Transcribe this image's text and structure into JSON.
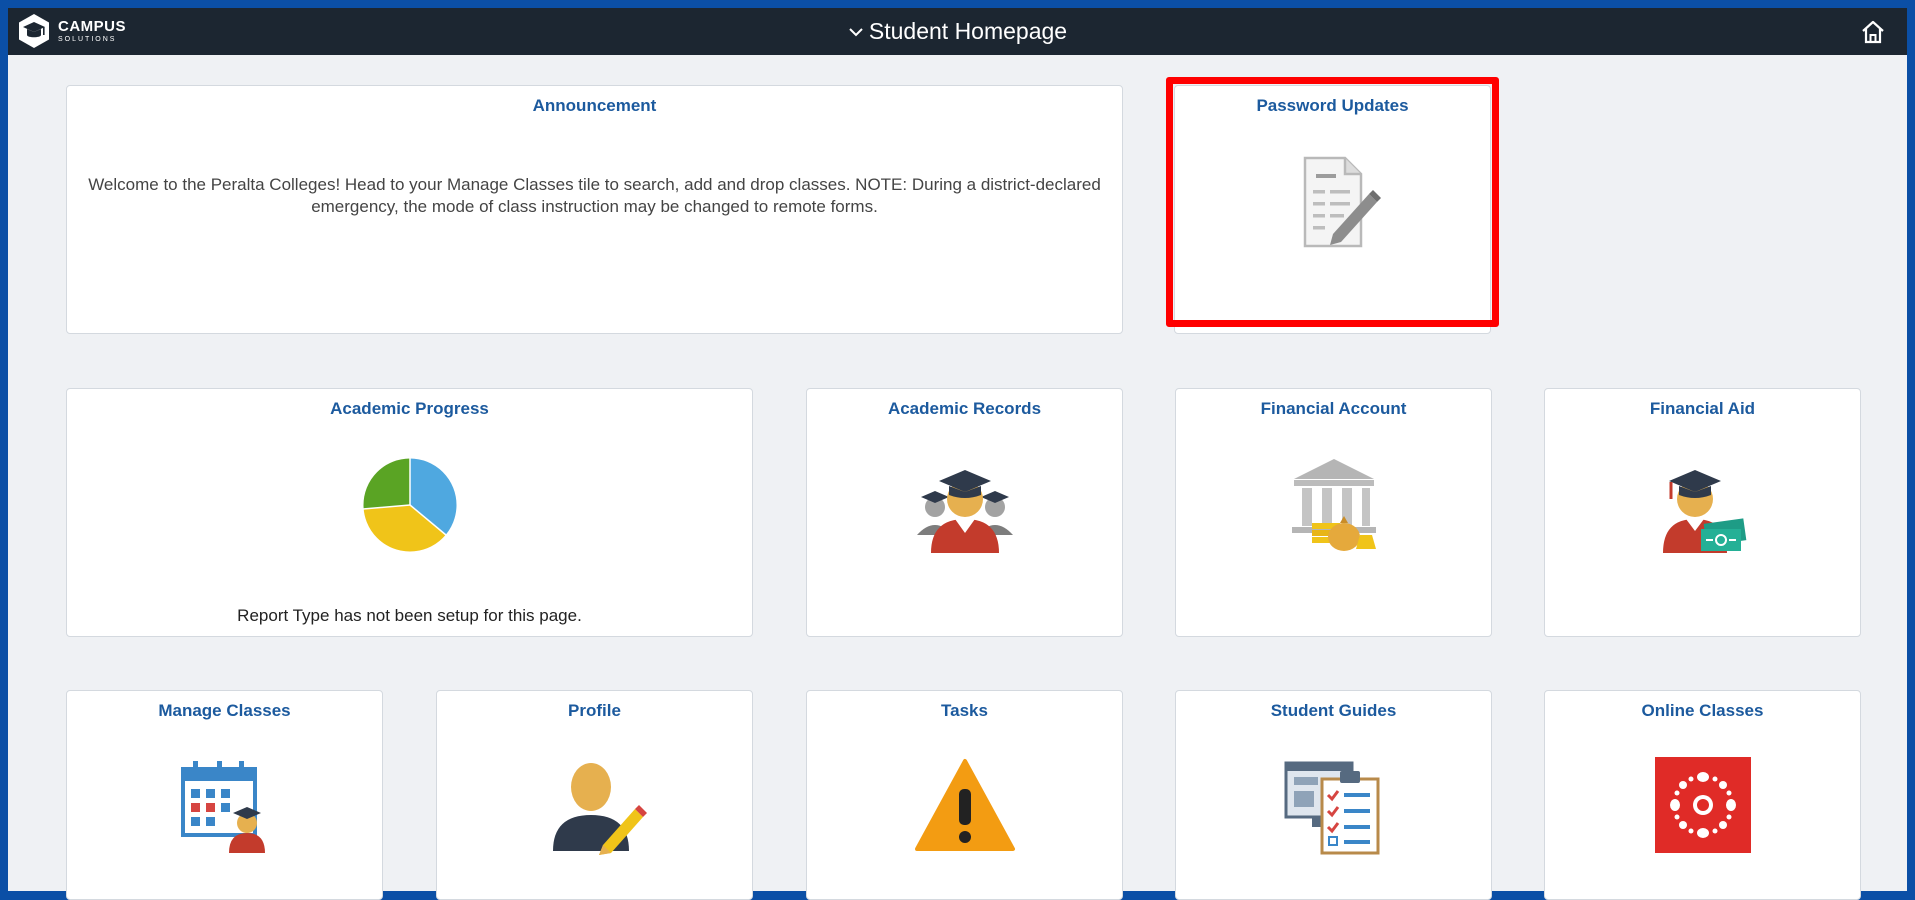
{
  "header": {
    "logo_big": "CAMPUS",
    "logo_small": "SOLUTIONS",
    "title": "Student Homepage",
    "title_icon": "chevron-down-icon",
    "home_icon": "home-icon"
  },
  "tiles": {
    "announcement": {
      "title": "Announcement",
      "text": "Welcome to the Peralta Colleges! Head to your Manage Classes tile to search, add and drop classes. NOTE: During a district-declared emergency, the mode of class instruction may be changed to remote forms."
    },
    "password_updates": {
      "title": "Password Updates",
      "icon": "document-edit-icon"
    },
    "academic_progress": {
      "title": "Academic Progress",
      "icon": "pie-chart-icon",
      "note": "Report Type has not been setup for this page."
    },
    "academic_records": {
      "title": "Academic Records",
      "icon": "graduates-icon"
    },
    "financial_account": {
      "title": "Financial Account",
      "icon": "bank-icon"
    },
    "financial_aid": {
      "title": "Financial Aid",
      "icon": "graduate-money-icon"
    },
    "manage_classes": {
      "title": "Manage Classes",
      "icon": "calendar-student-icon"
    },
    "profile": {
      "title": "Profile",
      "icon": "user-edit-icon"
    },
    "tasks": {
      "title": "Tasks",
      "icon": "warning-icon"
    },
    "student_guides": {
      "title": "Student Guides",
      "icon": "checklist-icon"
    },
    "online_classes": {
      "title": "Online Classes",
      "icon": "canvas-icon"
    }
  },
  "colors": {
    "border": "#0b4fa6",
    "header": "#1c2631",
    "tile_title": "#1c5a9e",
    "highlight": "#ff0000"
  }
}
